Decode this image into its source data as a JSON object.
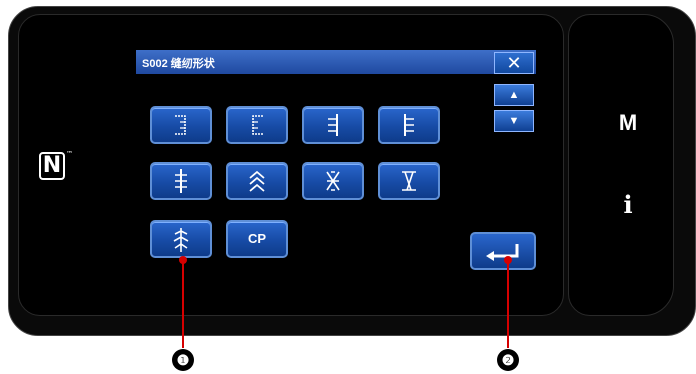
{
  "dialog": {
    "title": "S002 缝纫形状",
    "close_label": "✕",
    "scroll_up_label": "▲",
    "scroll_down_label": "▼"
  },
  "pattern_buttons": [
    {
      "name": "pattern-button-1",
      "icon": "bracket-open-icon"
    },
    {
      "name": "pattern-button-2",
      "icon": "bracket-open-left-icon"
    },
    {
      "name": "pattern-button-3",
      "icon": "bar-tack-right-icon"
    },
    {
      "name": "pattern-button-4",
      "icon": "bar-tack-left-icon"
    },
    {
      "name": "pattern-button-5",
      "icon": "bar-tack-straight-icon"
    },
    {
      "name": "pattern-button-6",
      "icon": "zigzag-taper-icon"
    },
    {
      "name": "pattern-button-7",
      "icon": "cross-taper-icon"
    },
    {
      "name": "pattern-button-8",
      "icon": "double-bracket-icon"
    },
    {
      "name": "pattern-button-9",
      "icon": "branch-taper-icon"
    }
  ],
  "cp_button": {
    "label": "CP"
  },
  "enter_button": {
    "icon": "enter-icon"
  },
  "side_panel": {
    "menu_label": "M",
    "info_label": "i"
  },
  "nfc": {
    "letter": "N",
    "mark": "™"
  },
  "callouts": [
    "❶",
    "❷"
  ],
  "colors": {
    "accent": "#1f55b8",
    "callout": "#d60000"
  }
}
